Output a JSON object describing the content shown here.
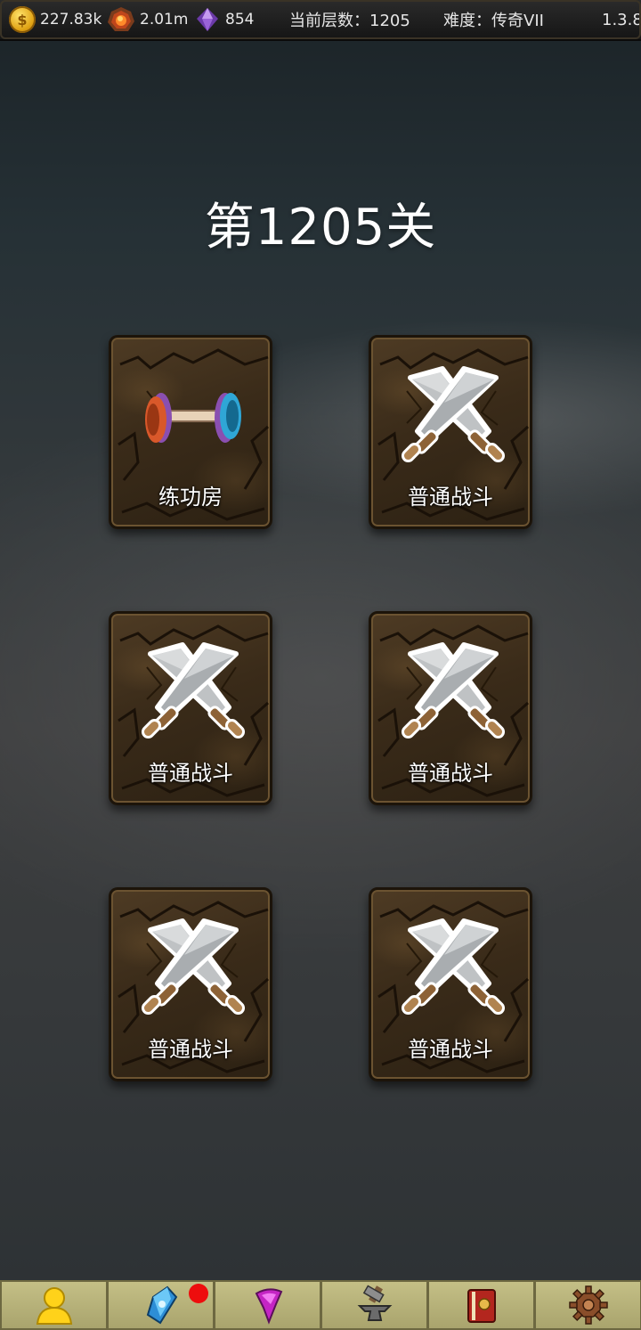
{
  "topbar": {
    "gold": "227.83k",
    "ore": "2.01m",
    "gems": "854",
    "floor_label": "当前层数：1205",
    "difficulty_label": "难度：传奇VII",
    "version": "1.3.8"
  },
  "level_title": "第1205关",
  "cards": [
    {
      "label": "练功房",
      "icon": "dumbbell-icon"
    },
    {
      "label": "普通战斗",
      "icon": "crossed-swords-icon"
    },
    {
      "label": "普通战斗",
      "icon": "crossed-swords-icon"
    },
    {
      "label": "普通战斗",
      "icon": "crossed-swords-icon"
    },
    {
      "label": "普通战斗",
      "icon": "crossed-swords-icon"
    },
    {
      "label": "普通战斗",
      "icon": "crossed-swords-icon"
    }
  ],
  "bottom_nav": [
    {
      "icon": "hero-icon"
    },
    {
      "icon": "crystal-icon",
      "badge": true
    },
    {
      "icon": "magic-gem-icon"
    },
    {
      "icon": "anvil-forge-icon"
    },
    {
      "icon": "spellbook-icon"
    },
    {
      "icon": "gear-settings-icon"
    }
  ],
  "colors": {
    "badge": "#ee0d0d",
    "nav_bg": "#b8b37a",
    "card_bg": "#3a2b19"
  }
}
